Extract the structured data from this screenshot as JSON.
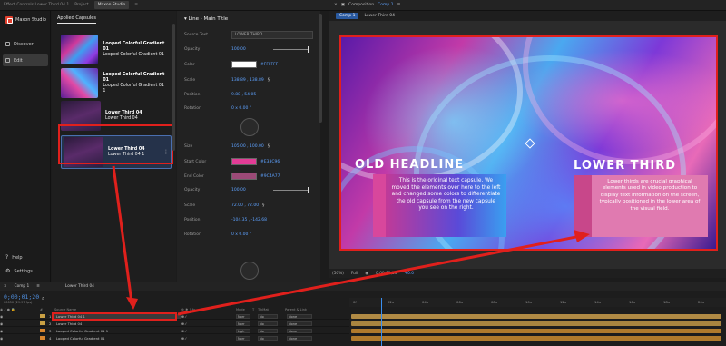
{
  "tabs": {
    "effect_controls": "Effect Controls",
    "effect_target": "Lower Third 04 1",
    "project": "Project",
    "maxon": "Maxon Studio"
  },
  "nav": {
    "brand": "Maxon Studio",
    "discover": "Discover",
    "edit": "Edit",
    "help": "Help",
    "settings": "Settings"
  },
  "capsules": {
    "header": "Applied Capsules",
    "items": [
      {
        "title": "Looped Colorful Gradient 01",
        "sub": "Looped Colorful Gradient 01"
      },
      {
        "title": "Looped Colorful Gradient 01",
        "sub": "Looped Colorful Gradient 01 1"
      },
      {
        "title": "Lower Third 04",
        "sub": "Lower Third 04"
      },
      {
        "title": "Lower Third 04",
        "sub": "Lower Third 04 1"
      }
    ]
  },
  "props": {
    "title": "Line - Main Title",
    "source_text_label": "Source Text",
    "source_text": "LOWER THIRD",
    "opacity_label": "Opacity",
    "opacity": "100.00",
    "color_label": "Color",
    "color": "#FFFFFF",
    "scale_label": "Scale",
    "scale": "138.89 , 138.89",
    "position_label": "Position",
    "position": "9.88 , 54.05",
    "rotation_label": "Rotation",
    "rotation": "0 x 0.00 °",
    "size_label": "Size",
    "size": "105.00 , 100.00",
    "start_color_label": "Start Color",
    "start_color": "#E33C96",
    "end_color_label": "End Color",
    "end_color": "#9C4A77",
    "opacity2_label": "Opacity",
    "opacity2": "100.00",
    "scale2_label": "Scale",
    "scale2": "72.00 , 72.00",
    "position2_label": "Position",
    "position2": "-104.35 , -142.68",
    "rotation2_label": "Rotation",
    "rotation2": "0 x 0.00 °"
  },
  "colors": {
    "start": "#E33C96",
    "end": "#9C4A77",
    "white": "#FFFFFF"
  },
  "comp": {
    "panel": "Composition",
    "panel_name": "Comp 1",
    "tab": "Comp 1",
    "crumb": "Lower Third 04",
    "zoom": "(50%)",
    "quality": "Full",
    "time": "0;00;01;20",
    "plus": "+0.0"
  },
  "canvas": {
    "old_headline": "OLD HEADLINE",
    "old_text": "This is the original text capsule. We moved the elements over here to the left and changed some colors to differentiate the old capsule from the new capsule you see on the right.",
    "lower_third": "LOWER THIRD",
    "lower_text": "Lower thirds are crucial graphical elements used in video production to display text information on the screen, typically positioned in the lower area of the visual field."
  },
  "timeline": {
    "tab": "Comp 1",
    "tab2": "Lower Third 04",
    "timecode": "0;00;01;20",
    "fps": "00050 (29.97 fps)",
    "cols": {
      "num": "#",
      "name": "Source Name",
      "mode": "Mode",
      "t": "T",
      "trkmat": "TrkMat",
      "parent": "Parent & Link"
    },
    "ruler": [
      "0f",
      "02s",
      "04s",
      "06s",
      "08s",
      "10s",
      "12s",
      "14s",
      "16s",
      "18s",
      "20s"
    ],
    "layers": [
      {
        "n": "1",
        "name": "Lower Third 04 1",
        "mode": "Norr",
        "trk": "No",
        "parent": "None"
      },
      {
        "n": "2",
        "name": "Lower Third 04",
        "mode": "Norr",
        "trk": "No",
        "parent": "None"
      },
      {
        "n": "3",
        "name": "Looped Colorful Gradient 01 1",
        "mode": "Ligh",
        "trk": "No",
        "parent": "None"
      },
      {
        "n": "4",
        "name": "Looped Colorful Gradient 01",
        "mode": "Norr",
        "trk": "No",
        "parent": "None"
      }
    ]
  }
}
